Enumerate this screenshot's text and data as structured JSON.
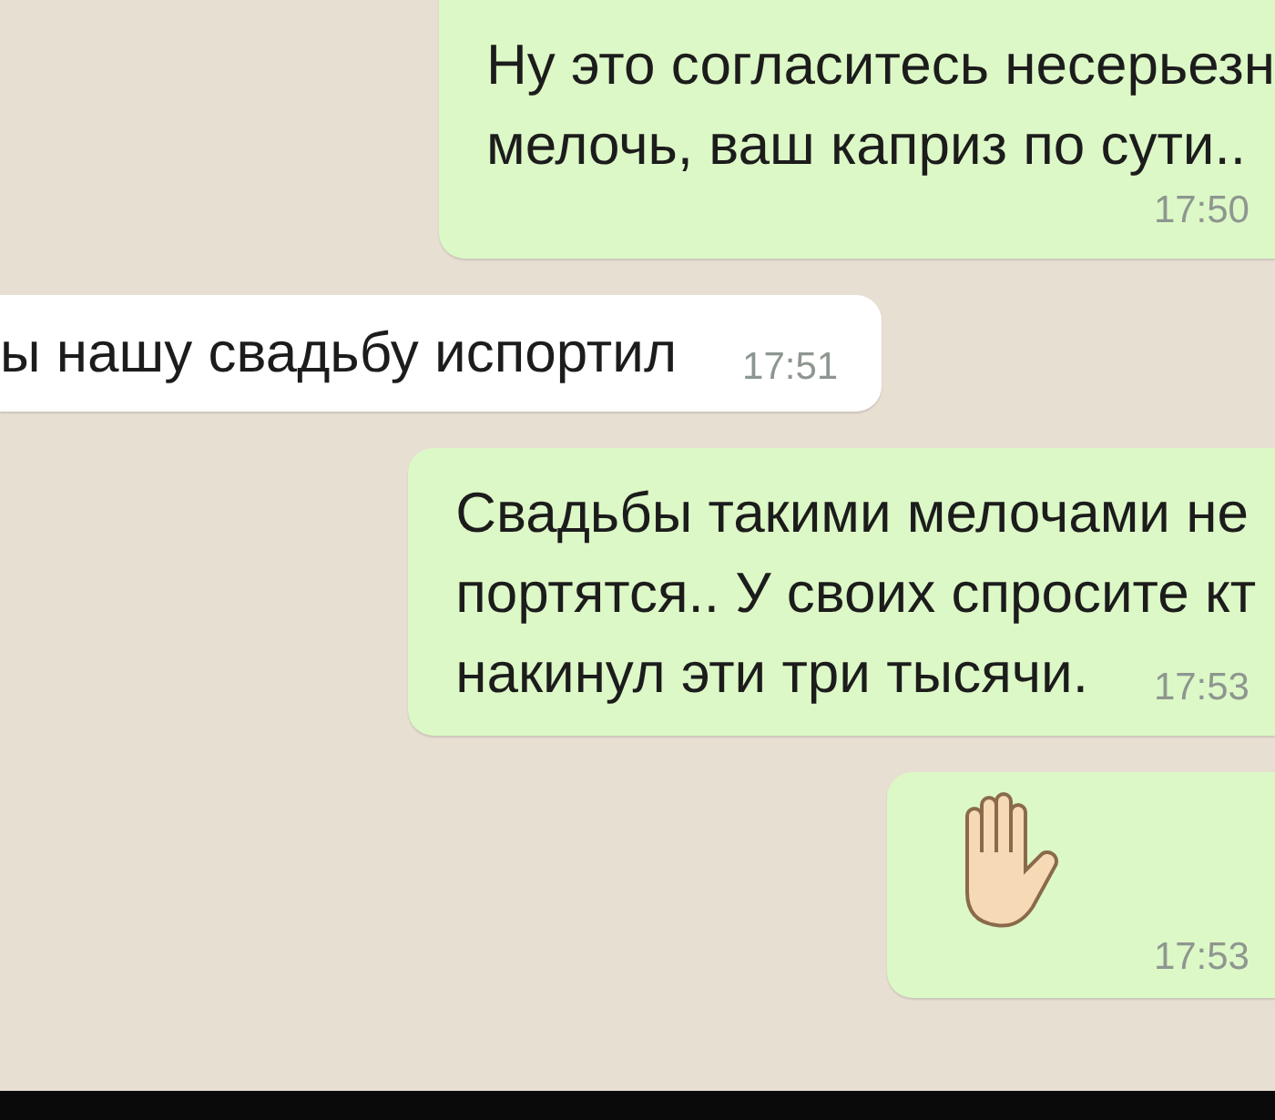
{
  "messages": [
    {
      "sent": true,
      "kind": "text",
      "lines": [
        "Ну это согласитесь несерьезн",
        "мелочь, ваш каприз по сути.."
      ],
      "time": "17:50",
      "time_inline": false
    },
    {
      "sent": false,
      "kind": "text",
      "lines": [
        "ы нашу свадьбу испортил"
      ],
      "time": "17:51",
      "time_inline": true
    },
    {
      "sent": true,
      "kind": "text",
      "lines": [
        "Свадьбы такими мелочами не",
        "портятся.. У своих спросите кт",
        "накинул эти три тысячи."
      ],
      "time": "17:53",
      "time_inline": true
    },
    {
      "sent": true,
      "kind": "emoji",
      "time": "17:53",
      "time_inline": false
    }
  ]
}
